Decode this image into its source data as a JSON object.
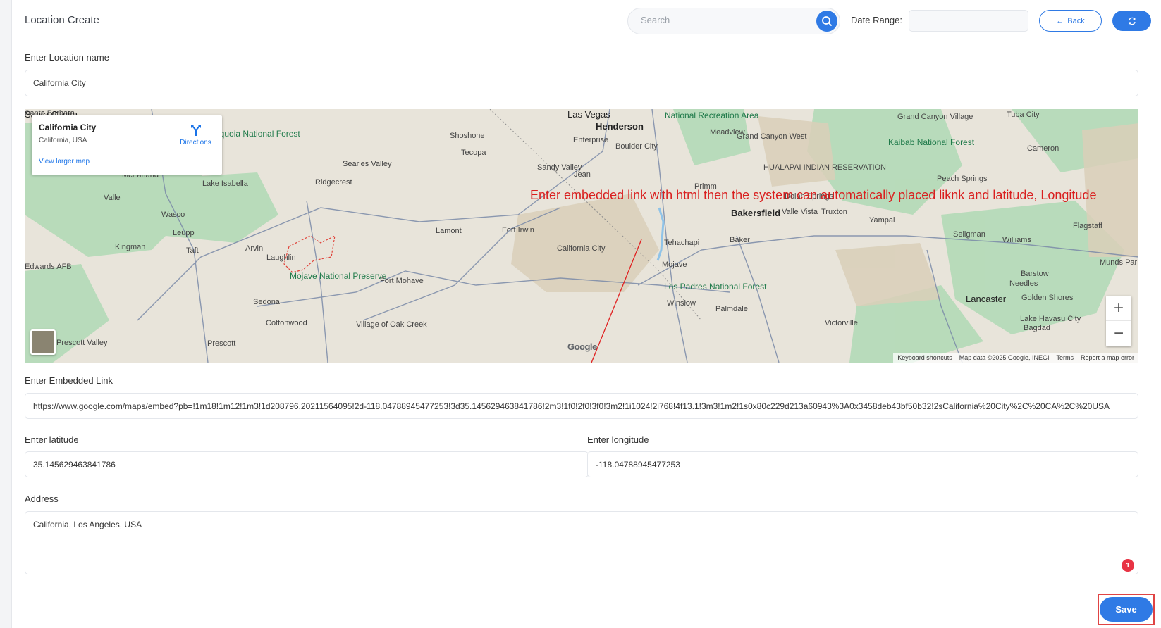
{
  "header": {
    "title": "Location Create",
    "search_placeholder": "Search",
    "date_range_label": "Date Range:",
    "date_range_value": "",
    "back_label": "Back"
  },
  "form": {
    "location_name_label": "Enter Location name",
    "location_name_value": "California City",
    "embedded_link_label": "Enter Embedded Link",
    "embedded_link_value": "https://www.google.com/maps/embed?pb=!1m18!1m12!1m3!1d208796.20211564095!2d-118.04788945477253!3d35.145629463841786!2m3!1f0!2f0!3f0!3m2!1i1024!2i768!4f13.1!3m3!1m2!1s0x80c229d213a60943%3A0x3458deb43bf50b32!2sCalifornia%20City%2C%20CA%2C%20USA",
    "latitude_label": "Enter latitude",
    "latitude_value": "35.145629463841786",
    "longitude_label": "Enter longitude",
    "longitude_value": "-118.04788945477253",
    "address_label": "Address",
    "address_value": "California, Los Angeles, USA",
    "error_count": "1",
    "save_label": "Save"
  },
  "map": {
    "card_title": "California City",
    "card_subtitle": "California, USA",
    "card_link": "View larger map",
    "directions_label": "Directions",
    "annotation": "Enter embedded link with html then the system can automatically placed liknk and latitude, Longitude",
    "footer": [
      "Keyboard shortcuts",
      "Map data ©2025 Google, INEGI",
      "Terms",
      "Report a map error"
    ],
    "logo": "Google",
    "places": [
      {
        "name": "Las Vegas",
        "cls": "city"
      },
      {
        "name": "Henderson",
        "cls": "big"
      },
      {
        "name": "Boulder City",
        "cls": ""
      },
      {
        "name": "Enterprise",
        "cls": ""
      },
      {
        "name": "National Recreation Area",
        "cls": "forest"
      },
      {
        "name": "Meadview",
        "cls": ""
      },
      {
        "name": "Grand Canyon West",
        "cls": ""
      },
      {
        "name": "Kaibab National Forest",
        "cls": "forest"
      },
      {
        "name": "HUALAPAI INDIAN RESERVATION",
        "cls": ""
      },
      {
        "name": "Grand Canyon Village",
        "cls": ""
      },
      {
        "name": "Tuba City",
        "cls": ""
      },
      {
        "name": "Cameron",
        "cls": ""
      },
      {
        "name": "Shoshone",
        "cls": ""
      },
      {
        "name": "Tecopa",
        "cls": ""
      },
      {
        "name": "Sequoia National Forest",
        "cls": "forest"
      },
      {
        "name": "Searles Valley",
        "cls": ""
      },
      {
        "name": "McFarland",
        "cls": ""
      },
      {
        "name": "Lake Isabella",
        "cls": ""
      },
      {
        "name": "Ridgecrest",
        "cls": ""
      },
      {
        "name": "Sandy Valley",
        "cls": ""
      },
      {
        "name": "Jean",
        "cls": ""
      },
      {
        "name": "Primm",
        "cls": ""
      },
      {
        "name": "Dolan Springs",
        "cls": ""
      },
      {
        "name": "Peach Springs",
        "cls": ""
      },
      {
        "name": "Valle",
        "cls": ""
      },
      {
        "name": "Wasco",
        "cls": ""
      },
      {
        "name": "Bakersfield",
        "cls": "big"
      },
      {
        "name": "Valle Vista",
        "cls": ""
      },
      {
        "name": "Truxton",
        "cls": ""
      },
      {
        "name": "Yampai",
        "cls": ""
      },
      {
        "name": "Seligman",
        "cls": ""
      },
      {
        "name": "Williams",
        "cls": ""
      },
      {
        "name": "Flagstaff",
        "cls": ""
      },
      {
        "name": "Leupp",
        "cls": ""
      },
      {
        "name": "Lamont",
        "cls": ""
      },
      {
        "name": "Fort Irwin",
        "cls": ""
      },
      {
        "name": "Baker",
        "cls": ""
      },
      {
        "name": "Kingman",
        "cls": ""
      },
      {
        "name": "Taft",
        "cls": ""
      },
      {
        "name": "Arvin",
        "cls": ""
      },
      {
        "name": "Tehachapi",
        "cls": ""
      },
      {
        "name": "California City",
        "cls": ""
      },
      {
        "name": "Laughlin",
        "cls": ""
      },
      {
        "name": "Mojave National Preserve",
        "cls": "forest"
      },
      {
        "name": "Mojave",
        "cls": ""
      },
      {
        "name": "Edwards AFB",
        "cls": ""
      },
      {
        "name": "Fort Mohave",
        "cls": ""
      },
      {
        "name": "Los Padres National Forest",
        "cls": "forest"
      },
      {
        "name": "Barstow",
        "cls": ""
      },
      {
        "name": "Needles",
        "cls": ""
      },
      {
        "name": "Munds Park",
        "cls": ""
      },
      {
        "name": "Sedona",
        "cls": ""
      },
      {
        "name": "Winslow",
        "cls": ""
      },
      {
        "name": "Lancaster",
        "cls": "city"
      },
      {
        "name": "Golden Shores",
        "cls": ""
      },
      {
        "name": "Cottonwood",
        "cls": ""
      },
      {
        "name": "Village of Oak Creek",
        "cls": ""
      },
      {
        "name": "Palmdale",
        "cls": ""
      },
      {
        "name": "Victorville",
        "cls": ""
      },
      {
        "name": "Lake Havasu City",
        "cls": ""
      },
      {
        "name": "Bagdad",
        "cls": ""
      },
      {
        "name": "Prescott Valley",
        "cls": ""
      },
      {
        "name": "Prescott",
        "cls": ""
      },
      {
        "name": "Santa Barbara",
        "cls": ""
      },
      {
        "name": "Santa Clarita",
        "cls": "city"
      }
    ]
  },
  "colors": {
    "accent": "#2f7ae5",
    "annotation": "#d91f1f",
    "error": "#e83344"
  }
}
